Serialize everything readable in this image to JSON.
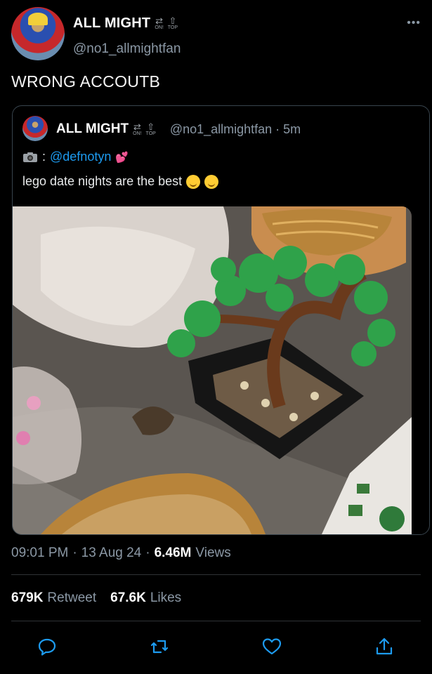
{
  "author": {
    "display_name": "ALL MIGHT",
    "handle": "@no1_allmightfan",
    "badge_on": "ON!",
    "badge_top": "TOP"
  },
  "more_label": "•••",
  "tweet": {
    "text": "WRONG ACCOUTB"
  },
  "quote": {
    "display_name": "ALL MIGHT",
    "handle_time": "@no1_allmightfan · 5m",
    "credit_prefix": ":",
    "mention": "@defnotyn",
    "text": "lego date nights are the best"
  },
  "meta": {
    "time": "09:01 PM",
    "sep": "·",
    "date": "13 Aug 24",
    "views_count": "6.46M",
    "views_label": "Views"
  },
  "stats": {
    "retweets_count": "679K",
    "retweets_label": "Retweet",
    "likes_count": "67.6K",
    "likes_label": "Likes"
  },
  "icons": {
    "reply": "reply-icon",
    "retweet": "retweet-icon",
    "like": "heart-icon",
    "share": "share-icon"
  },
  "colors": {
    "background": "#000000",
    "link": "#1d9bf0",
    "secondary_text": "#8b98a5",
    "action_icon": "#1d9bf0"
  }
}
